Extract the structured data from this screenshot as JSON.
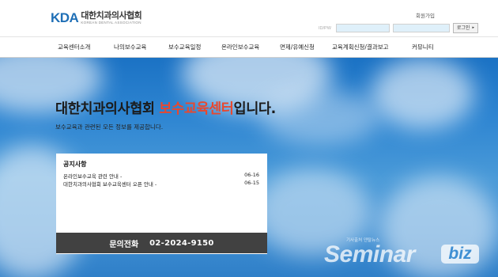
{
  "header": {
    "logo_mark": "KDA",
    "logo_korean": "대한치과의사협회",
    "logo_english": "KOREAN DENTAL ASSOCIATION",
    "join_link": "회원가입",
    "id_pw_label": "ID/PW",
    "login_button": "로그인"
  },
  "nav": {
    "items": [
      {
        "label": "교육센터소개"
      },
      {
        "label": "나의보수교육"
      },
      {
        "label": "보수교육일정"
      },
      {
        "label": "온라인보수교육"
      },
      {
        "label": "면제/유예신청"
      },
      {
        "label": "교육계획신청/결과보고"
      },
      {
        "label": "커뮤니티"
      }
    ]
  },
  "hero": {
    "headline_before": "대한치과의사협회 ",
    "headline_accent": "보수교육센터",
    "headline_after": "입니다.",
    "subline": "보수교육과 관련된 모든 정보를 제공합니다.",
    "accent_color": "#e8482f"
  },
  "notice": {
    "title": "공지사항",
    "items": [
      {
        "title": "온라인보수교육 관련 안내 -",
        "date": "06-16"
      },
      {
        "title": "대한치과의사협회 보수교육센터 오픈 안내 -",
        "date": "06-15"
      }
    ]
  },
  "contact": {
    "label": "문의전화",
    "phone": "02-2024-9150"
  },
  "watermark": {
    "tagline": "기사출처 덴탈뉴스",
    "brand": "Seminar",
    "brand_badge": "biz"
  }
}
